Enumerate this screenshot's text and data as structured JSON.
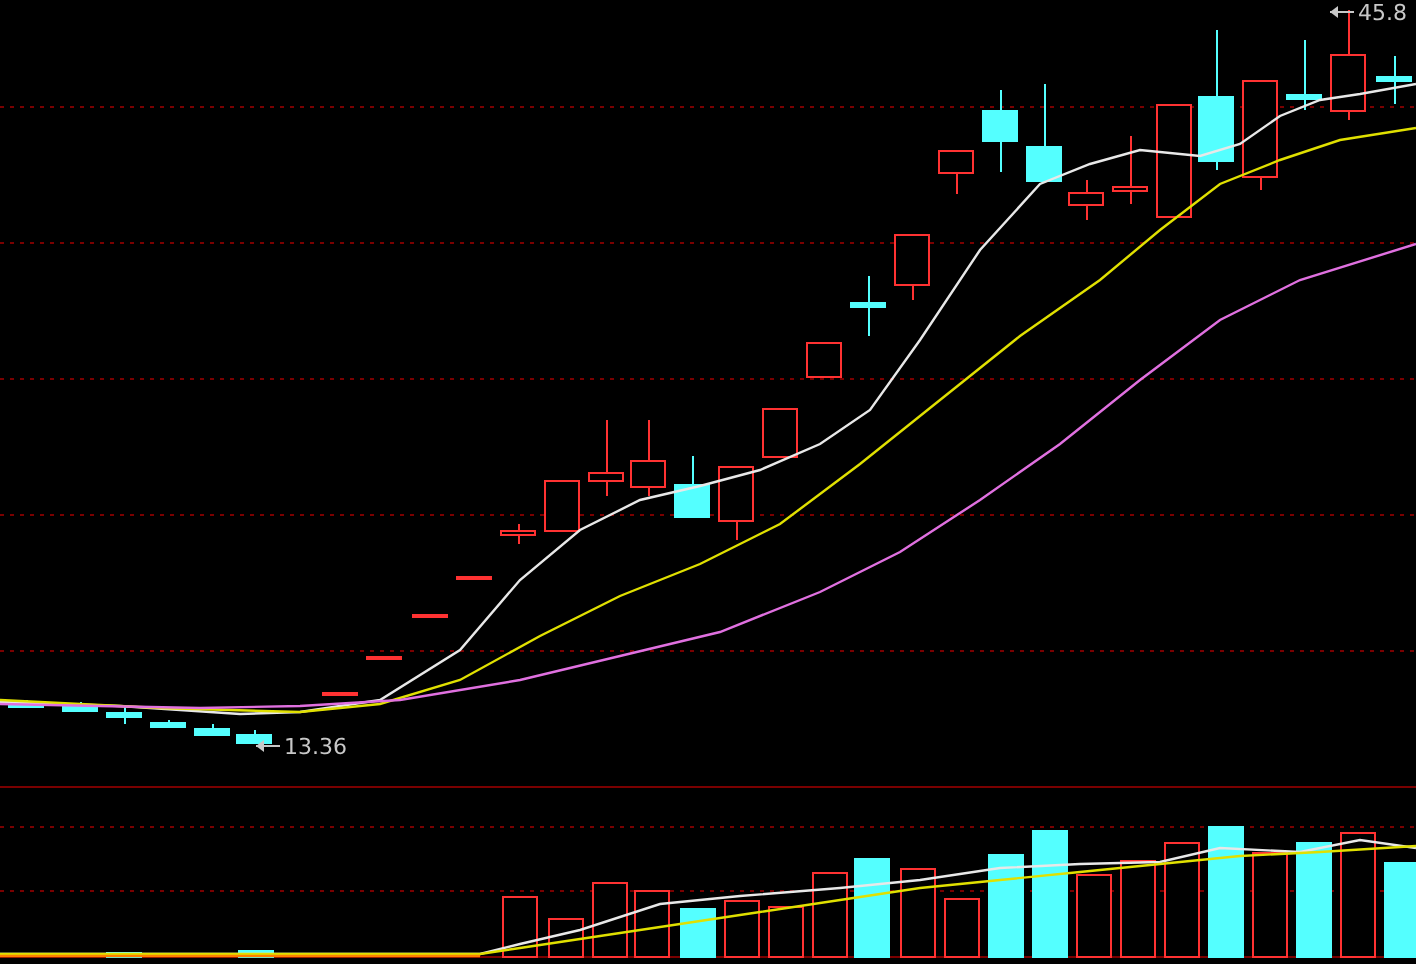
{
  "chart": {
    "high_label": "45.8",
    "low_label": "13.36"
  }
}
